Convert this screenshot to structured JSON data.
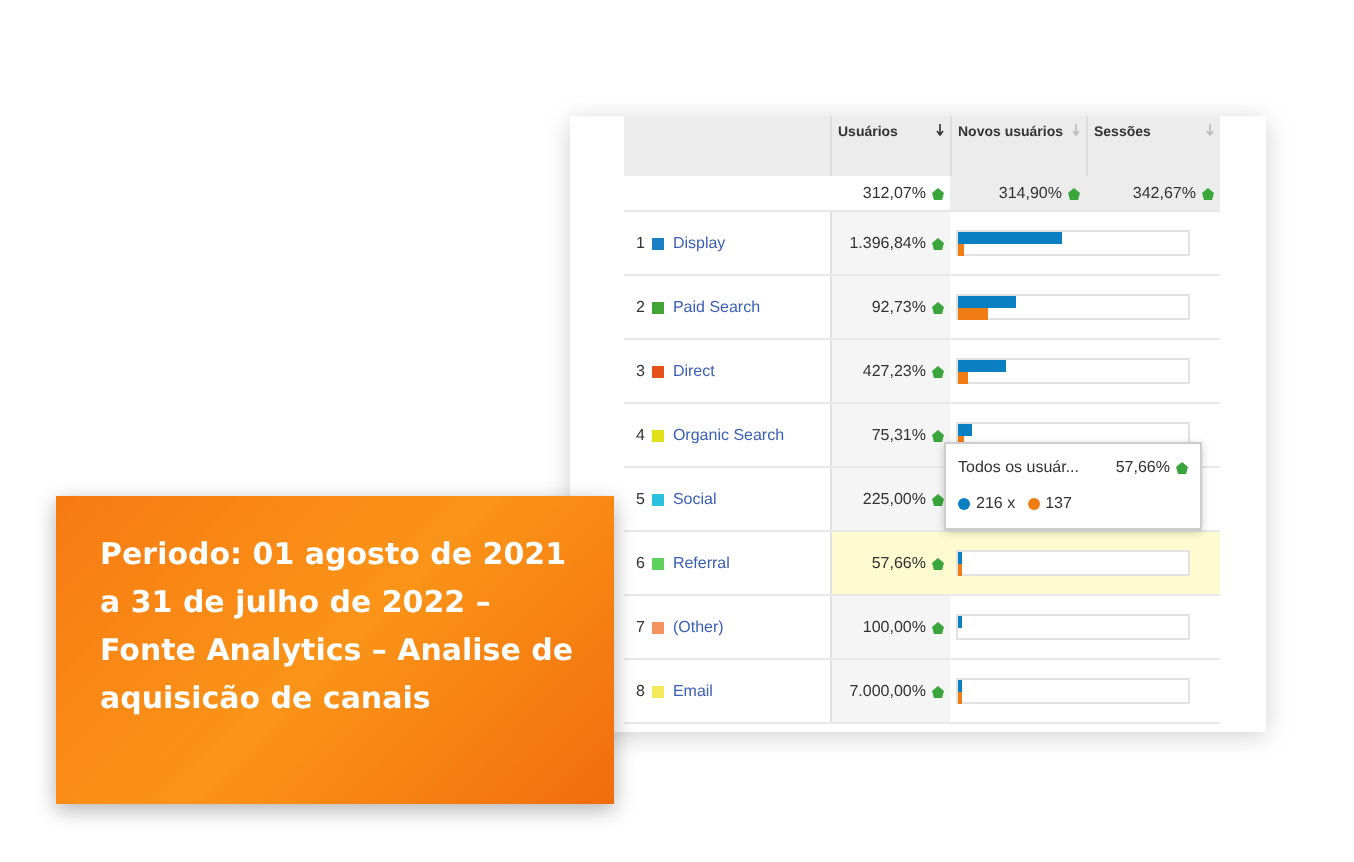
{
  "report": {
    "columns": [
      {
        "label": "Usuários",
        "sorted": true
      },
      {
        "label": "Novos usuários",
        "sorted": false
      },
      {
        "label": "Sessões",
        "sorted": false
      }
    ],
    "totals": [
      "312,07%",
      "314,90%",
      "342,67%"
    ],
    "rows": [
      {
        "index": "1",
        "name": "Display",
        "color": "#1a7fc4",
        "value": "1.396,84%",
        "selected": false,
        "bars": [
          {
            "level": 0.45
          },
          {
            "level": 0.03
          }
        ]
      },
      {
        "index": "2",
        "name": "Paid Search",
        "color": "#3fa535",
        "value": "92,73%",
        "selected": false,
        "bars": [
          {
            "level": 0.25
          },
          {
            "level": 0.13
          }
        ]
      },
      {
        "index": "3",
        "name": "Direct",
        "color": "#e5531a",
        "value": "427,23%",
        "selected": false,
        "bars": [
          {
            "level": 0.21
          },
          {
            "level": 0.04
          }
        ]
      },
      {
        "index": "4",
        "name": "Organic Search",
        "color": "#e3e01a",
        "value": "75,31%",
        "selected": false,
        "bars": [
          {
            "level": 0.06
          },
          {
            "level": 0.03
          }
        ]
      },
      {
        "index": "5",
        "name": "Social",
        "color": "#2bbfe0",
        "value": "225,00%",
        "selected": false
      },
      {
        "index": "6",
        "name": "Referral",
        "color": "#5dd35d",
        "value": "57,66%",
        "selected": true,
        "bars": [
          {
            "level": 0.01
          },
          {
            "level": 0.01
          }
        ]
      },
      {
        "index": "7",
        "name": "(Other)",
        "color": "#f4935e",
        "value": "100,00%",
        "selected": false,
        "bars": [
          {
            "level": 0.01
          }
        ]
      },
      {
        "index": "8",
        "name": "Email",
        "color": "#f5e95a",
        "value": "7.000,00%",
        "selected": false,
        "bars": [
          {
            "level": 0.01
          },
          {
            "level": 0.01
          }
        ]
      }
    ],
    "tooltip": {
      "label": "Todos os usuár...",
      "value": "57,66%",
      "items": [
        {
          "value": "216 x",
          "color": "#0a7fc2"
        },
        {
          "value": "137",
          "color": "#ef7d14"
        }
      ]
    }
  },
  "caption": "Periodo: 01 agosto de 2021 a 31 de julho de 2022 – Fonte Analytics – Analise de aquisicão de canais"
}
